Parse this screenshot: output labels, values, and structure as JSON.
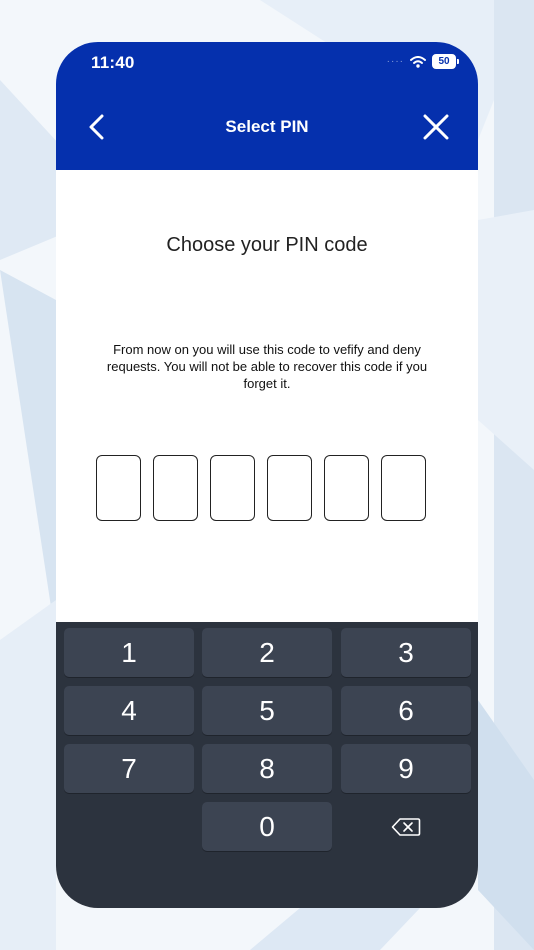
{
  "status_bar": {
    "time": "11:40",
    "signal_icon": "signal-dots-icon",
    "wifi_icon": "wifi-icon",
    "battery_level": "50"
  },
  "header": {
    "title": "Select PIN",
    "back_icon": "chevron-left-icon",
    "close_icon": "close-icon",
    "color": "#0530ad"
  },
  "content": {
    "title": "Choose your PIN code",
    "description": "From now on you will use this code to vefify and deny requests. You will not be able to recover this code if you forget it.",
    "pin_length": 6,
    "pin_entered": 0
  },
  "keypad": {
    "keys": [
      "1",
      "2",
      "3",
      "4",
      "5",
      "6",
      "7",
      "8",
      "9",
      "0"
    ],
    "delete_icon": "backspace-icon",
    "background": "#2c333e",
    "key_color": "#3c4452"
  }
}
